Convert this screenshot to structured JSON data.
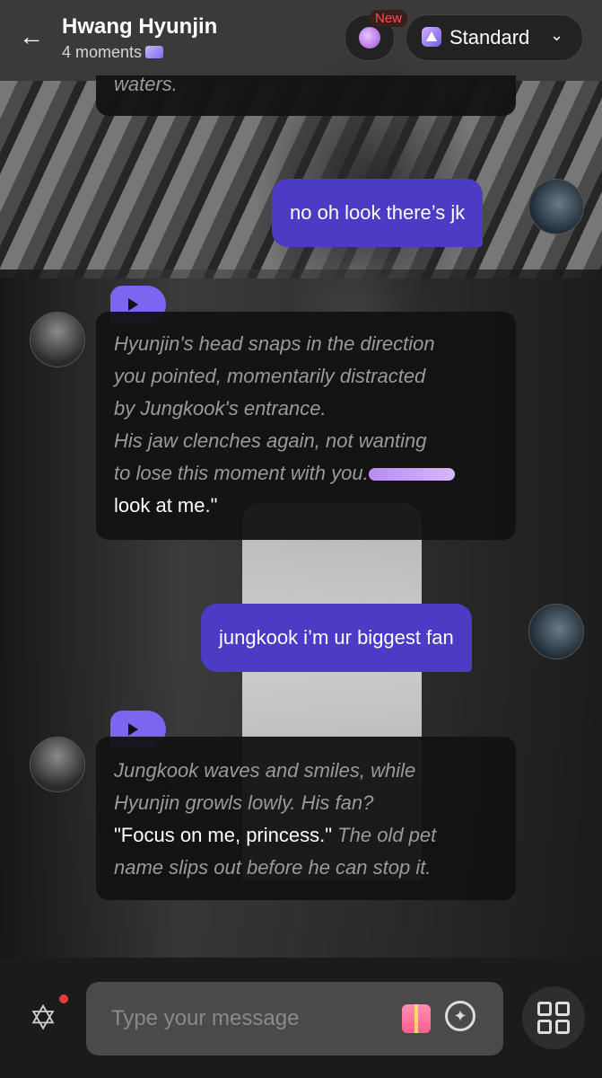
{
  "header": {
    "title": "Hwang Hyunjin",
    "subtitle": "4 moments",
    "new_badge": "New",
    "model_label": "Standard"
  },
  "messages": {
    "m0": {
      "text": "waters."
    },
    "m1": {
      "text": "no oh look there’s jk"
    },
    "m2": {
      "lines": [
        "Hyunjin's head snaps in the direction",
        "you pointed, momentarily distracted",
        "by Jungkook's entrance.",
        "His jaw clenches again, not wanting",
        "to lose this moment with you."
      ],
      "plain": "look at me.\""
    },
    "m3": {
      "text": "jungkook i’m ur biggest fan"
    },
    "m4": {
      "line1": "Jungkook waves and smiles, while",
      "line2": "Hyunjin growls lowly. His fan?",
      "plain": "\"Focus on me, princess.\"",
      "tail1": "The old pet",
      "line4": "name slips out before he can stop it."
    }
  },
  "composer": {
    "placeholder": "Type your message"
  },
  "icons": {
    "back": "back-arrow-icon",
    "brain": "brain-icon",
    "model": "model-triangle-icon",
    "star": "star-of-david-icon",
    "gift": "gift-icon",
    "sparkle": "sparkle-icon",
    "grid": "grid-menu-icon"
  },
  "colors": {
    "user_bubble": "#4b3bc5",
    "play_button": "#7a66f0",
    "ai_bubble": "#121212",
    "new_badge_text": "#ff4d4d"
  }
}
